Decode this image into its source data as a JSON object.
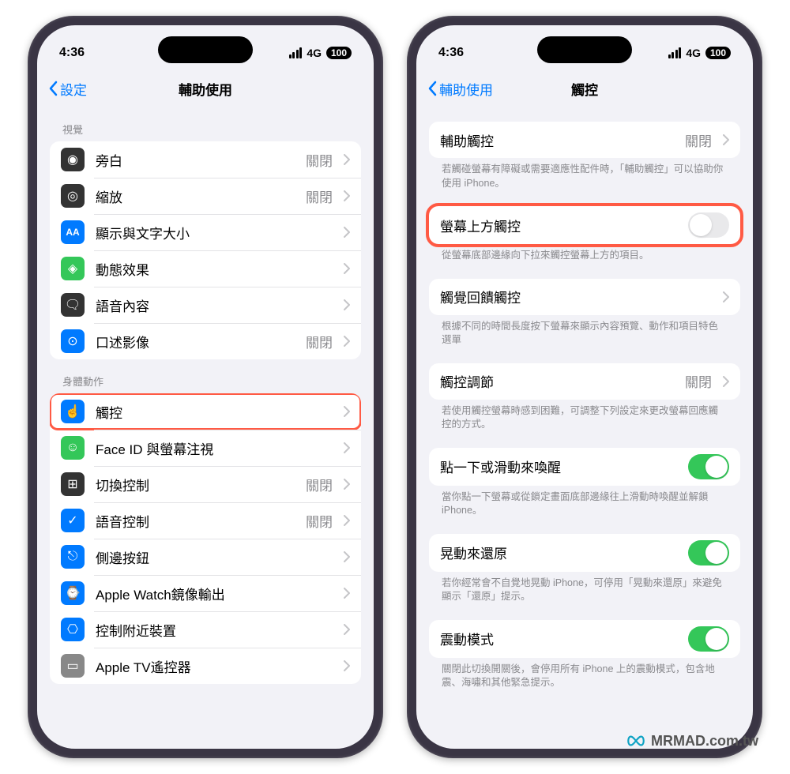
{
  "status": {
    "time": "4:36",
    "network": "4G",
    "battery": "100"
  },
  "left": {
    "back": "設定",
    "title": "輔助使用",
    "section1_header": "視覺",
    "section2_header": "身體動作",
    "items1": [
      {
        "label": "旁白",
        "status": "關閉",
        "icon_bg": "#333333"
      },
      {
        "label": "縮放",
        "status": "關閉",
        "icon_bg": "#333333"
      },
      {
        "label": "顯示與文字大小",
        "status": "",
        "icon_bg": "#007aff"
      },
      {
        "label": "動態效果",
        "status": "",
        "icon_bg": "#34c759"
      },
      {
        "label": "語音內容",
        "status": "",
        "icon_bg": "#333333"
      },
      {
        "label": "口述影像",
        "status": "關閉",
        "icon_bg": "#007aff"
      }
    ],
    "items2": [
      {
        "label": "觸控",
        "status": "",
        "icon_bg": "#007aff",
        "highlight": true
      },
      {
        "label": "Face ID 與螢幕注視",
        "status": "",
        "icon_bg": "#34c759"
      },
      {
        "label": "切換控制",
        "status": "關閉",
        "icon_bg": "#333333"
      },
      {
        "label": "語音控制",
        "status": "關閉",
        "icon_bg": "#007aff"
      },
      {
        "label": "側邊按鈕",
        "status": "",
        "icon_bg": "#007aff"
      },
      {
        "label": "Apple Watch鏡像輸出",
        "status": "",
        "icon_bg": "#007aff"
      },
      {
        "label": "控制附近裝置",
        "status": "",
        "icon_bg": "#007aff"
      },
      {
        "label": "Apple TV遙控器",
        "status": "",
        "icon_bg": "#888888"
      }
    ]
  },
  "right": {
    "back": "輔助使用",
    "title": "觸控",
    "g1_label": "輔助觸控",
    "g1_status": "關閉",
    "g1_footer": "若觸碰螢幕有障礙或需要適應性配件時，「輔助觸控」可以協助你使用 iPhone。",
    "g2_label": "螢幕上方觸控",
    "g2_footer": "從螢幕底部邊緣向下拉來觸控螢幕上方的項目。",
    "g3_label": "觸覺回饋觸控",
    "g3_footer": "根據不同的時間長度按下螢幕來顯示內容預覽、動作和項目特色選單",
    "g4_label": "觸控調節",
    "g4_status": "關閉",
    "g4_footer": "若使用觸控螢幕時感到困難，可調整下列設定來更改螢幕回應觸控的方式。",
    "g5_label": "點一下或滑動來喚醒",
    "g5_footer": "當你點一下螢幕或從鎖定畫面底部邊緣往上滑動時喚醒並解鎖 iPhone。",
    "g6_label": "晃動來還原",
    "g6_footer": "若你經常會不自覺地晃動 iPhone，可停用「晃動來還原」來避免顯示「還原」提示。",
    "g7_label": "震動模式",
    "g7_footer": "關閉此切換開關後，會停用所有 iPhone 上的震動模式，包含地震、海嘯和其他緊急提示。"
  },
  "watermark": "MRMAD.com.tw"
}
